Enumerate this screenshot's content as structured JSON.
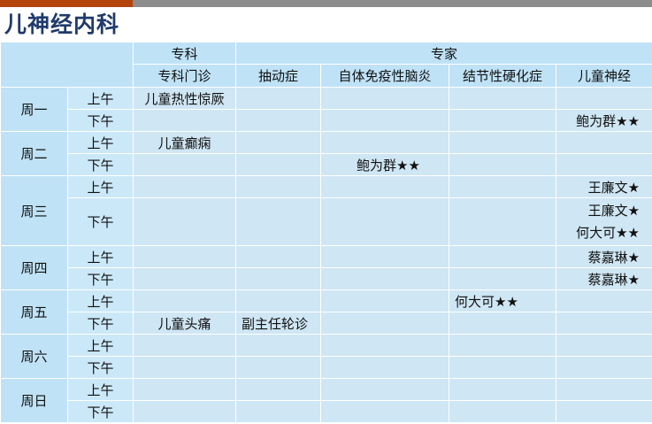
{
  "title": "儿神经内科",
  "header": {
    "specialty_group": "专科",
    "expert_group": "专家",
    "specialty_clinic": "专科门诊",
    "experts": [
      "抽动症",
      "自体免疫性脑炎",
      "结节性硬化症",
      "儿童神经"
    ]
  },
  "days": [
    {
      "day": "周一",
      "slots": [
        {
          "half": "上午",
          "specialty": "儿童热性惊厥",
          "e1": "",
          "e2": "",
          "e3": "",
          "e4": ""
        },
        {
          "half": "下午",
          "specialty": "",
          "e1": "",
          "e2": "",
          "e3": "",
          "e4": "鲍为群★★"
        }
      ]
    },
    {
      "day": "周二",
      "slots": [
        {
          "half": "上午",
          "specialty": "儿童癫痫",
          "e1": "",
          "e2": "",
          "e3": "",
          "e4": ""
        },
        {
          "half": "下午",
          "specialty": "",
          "e1": "",
          "e2": "鲍为群★★",
          "e3": "",
          "e4": ""
        }
      ]
    },
    {
      "day": "周三",
      "slots": [
        {
          "half": "上午",
          "specialty": "",
          "e1": "",
          "e2": "",
          "e3": "",
          "e4": "王廉文★"
        },
        {
          "half": "下午",
          "specialty": "",
          "e1": "",
          "e2": "",
          "e3": "",
          "e4": "王廉文★",
          "e4b": "何大可★★"
        }
      ]
    },
    {
      "day": "周四",
      "slots": [
        {
          "half": "上午",
          "specialty": "",
          "e1": "",
          "e2": "",
          "e3": "",
          "e4": "蔡嘉琳★"
        },
        {
          "half": "下午",
          "specialty": "",
          "e1": "",
          "e2": "",
          "e3": "",
          "e4": "蔡嘉琳★"
        }
      ]
    },
    {
      "day": "周五",
      "slots": [
        {
          "half": "上午",
          "specialty": "",
          "e1": "",
          "e2": "",
          "e3": "何大可★★",
          "e4": ""
        },
        {
          "half": "下午",
          "specialty": "儿童头痛",
          "e1": "副主任轮诊",
          "e2": "",
          "e3": "",
          "e4": ""
        }
      ]
    },
    {
      "day": "周六",
      "slots": [
        {
          "half": "上午",
          "specialty": "",
          "e1": "",
          "e2": "",
          "e3": "",
          "e4": ""
        },
        {
          "half": "下午",
          "specialty": "",
          "e1": "",
          "e2": "",
          "e3": "",
          "e4": ""
        }
      ]
    },
    {
      "day": "周日",
      "slots": [
        {
          "half": "上午",
          "specialty": "",
          "e1": "",
          "e2": "",
          "e3": "",
          "e4": ""
        },
        {
          "half": "下午",
          "specialty": "",
          "e1": "",
          "e2": "",
          "e3": "",
          "e4": ""
        }
      ]
    }
  ]
}
